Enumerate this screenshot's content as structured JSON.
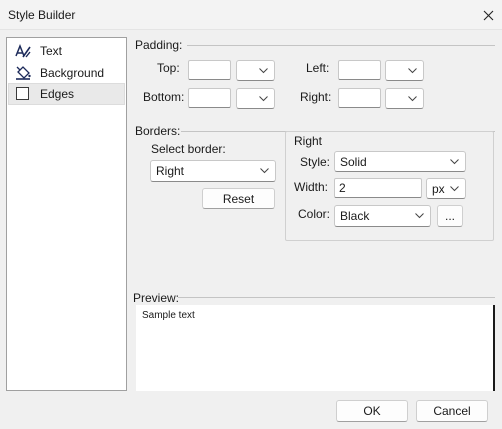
{
  "window": {
    "title": "Style Builder"
  },
  "sidebar": {
    "items": [
      {
        "label": "Text",
        "icon": "text-style-icon"
      },
      {
        "label": "Background",
        "icon": "paint-bucket-icon"
      },
      {
        "label": "Edges",
        "icon": "edges-box-icon",
        "selected": true
      }
    ]
  },
  "padding": {
    "group_label": "Padding:",
    "top_label": "Top:",
    "bottom_label": "Bottom:",
    "left_label": "Left:",
    "right_label": "Right:",
    "top_value": "",
    "top_unit": "",
    "bottom_value": "",
    "bottom_unit": "",
    "left_value": "",
    "left_unit": "",
    "right_value": "",
    "right_unit": ""
  },
  "borders": {
    "group_label": "Borders:",
    "select_label": "Select border:",
    "selected_border": "Right",
    "reset_label": "Reset",
    "detail": {
      "header": "Right",
      "style_label": "Style:",
      "style_value": "Solid",
      "width_label": "Width:",
      "width_value": "2",
      "width_unit": "px",
      "color_label": "Color:",
      "color_value": "Black",
      "more_label": "..."
    }
  },
  "preview": {
    "label": "Preview:",
    "sample": "Sample text"
  },
  "footer": {
    "ok_label": "OK",
    "cancel_label": "Cancel"
  }
}
